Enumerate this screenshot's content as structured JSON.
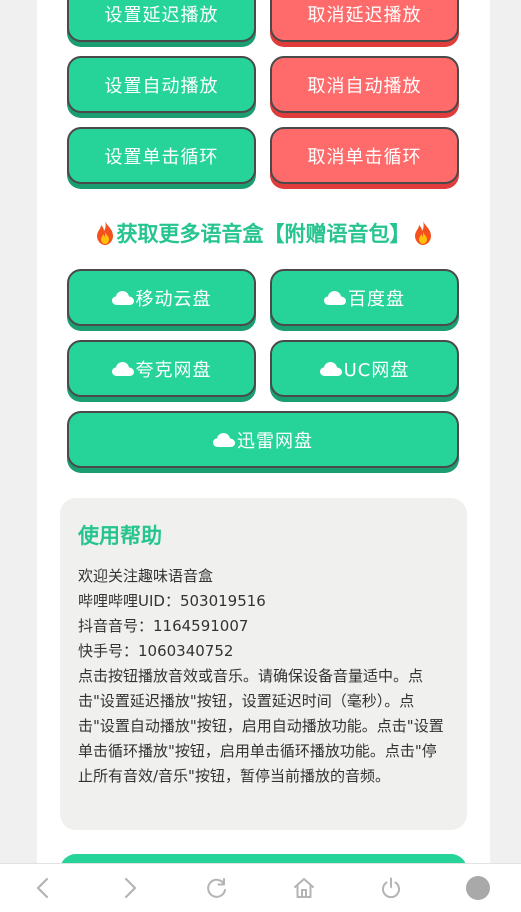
{
  "buttons": {
    "set_delay": "设置延迟播放",
    "cancel_delay": "取消延迟播放",
    "set_autoplay": "设置自动播放",
    "cancel_autoplay": "取消自动播放",
    "set_loop": "设置单击循环",
    "cancel_loop": "取消单击循环"
  },
  "section": {
    "title": "获取更多语音盒【附赠语音包】",
    "fire_icon": "fire-icon"
  },
  "cloud_links": [
    {
      "label": "移动云盘",
      "icon": "cloud-icon"
    },
    {
      "label": "百度盘",
      "icon": "cloud-icon"
    },
    {
      "label": "夸克网盘",
      "icon": "cloud-icon"
    },
    {
      "label": "UC网盘",
      "icon": "cloud-icon"
    },
    {
      "label": "迅雷网盘",
      "icon": "cloud-icon"
    }
  ],
  "help": {
    "title": "使用帮助",
    "lines": [
      "欢迎关注趣味语音盒",
      "哔哩哔哩UID：503019516",
      "抖音音号：1164591007",
      "快手号：1060340752",
      "点击按钮播放音效或音乐。请确保设备音量适中。点击\"设置延迟播放\"按钮，设置延迟时间（毫秒）。点击\"设置自动播放\"按钮，启用自动播放功能。点击\"设置单击循环播放\"按钮，启用单击循环播放功能。点击\"停止所有音效/音乐\"按钮，暂停当前播放的音频。"
    ]
  },
  "colors": {
    "green": "#26d49a",
    "red": "#ff6b6b",
    "title_green": "#26c48f"
  },
  "navbar": [
    "back-icon",
    "forward-icon",
    "refresh-icon",
    "home-icon",
    "power-icon",
    "menu-dot-icon"
  ]
}
